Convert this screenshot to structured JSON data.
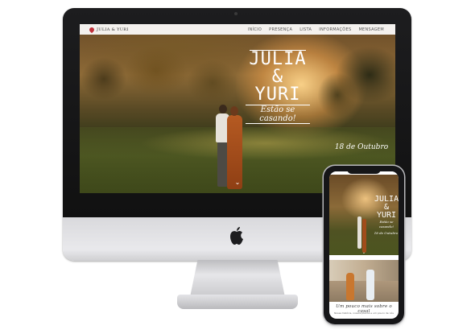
{
  "site": {
    "logo_text": "JULIA & YURI",
    "nav": [
      "INÍCIO",
      "PRESENÇA",
      "LISTA",
      "INFORMAÇÕES",
      "MENSAGEM"
    ]
  },
  "hero": {
    "name_line1": "JULIA",
    "name_line2": "& YURI",
    "tagline": "Estão se casando!",
    "date": "18 de Outubro"
  },
  "phone": {
    "name_line1": "JULIA",
    "name_line2": "& YURI",
    "tagline": "Estão se casando!",
    "date": "18 de Outubro",
    "caption": "Um pouco mais sobre o casal",
    "caption_sub": "Nossa história, nossos planos e um pouco de nós"
  },
  "icons": {
    "apple": "apple-logo-icon",
    "chevron": "chevron-down-icon",
    "heart": "heart-icon"
  },
  "colors": {
    "accent": "#c0303a",
    "device_frame": "#161618"
  }
}
